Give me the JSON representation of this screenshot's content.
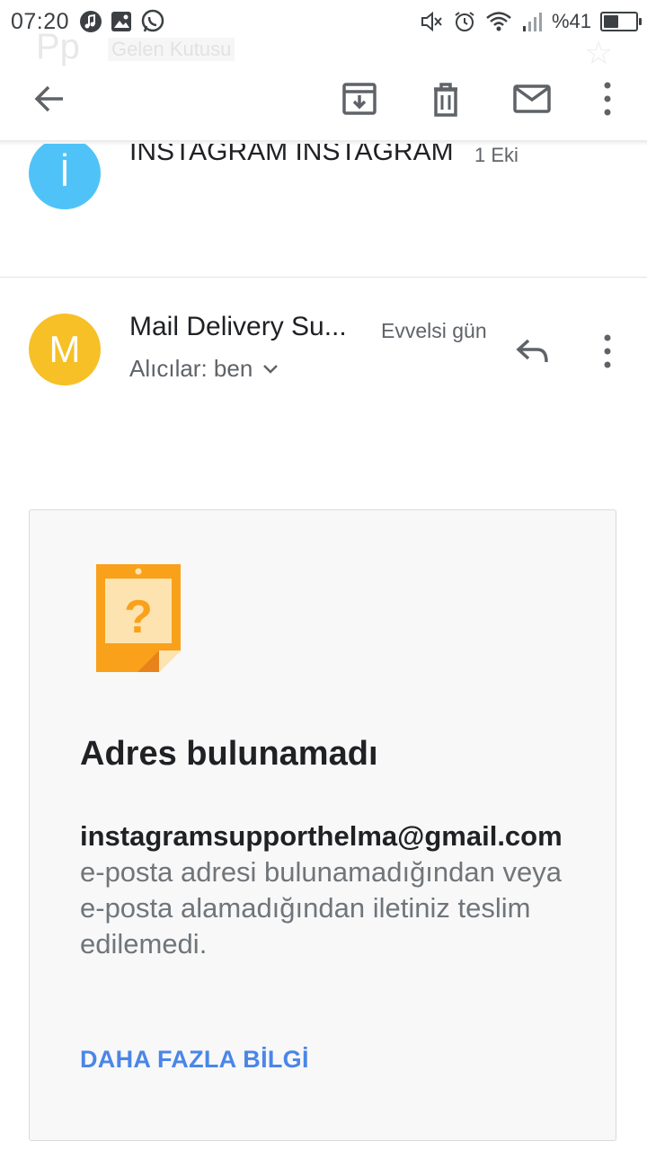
{
  "status_bar": {
    "time": "07:20",
    "left_icons": [
      "music-note-icon",
      "image-icon",
      "whatsapp-icon"
    ],
    "right_icons": [
      "mute-icon",
      "alarm-icon",
      "wifi-icon",
      "signal-icon"
    ],
    "battery_text": "%41",
    "battery_level": 0.41
  },
  "background": {
    "faded_initials": "Pp",
    "faded_folder_label": "Gelen Kutusu"
  },
  "toolbar": {
    "icons": [
      "back-arrow-icon",
      "archive-icon",
      "delete-icon",
      "mark-unread-icon",
      "more-vert-icon"
    ]
  },
  "messages": [
    {
      "avatar_letter": "İ",
      "avatar_color": "#4fc3f7",
      "sender": "İNSTAGRAM İNSTAGRAM",
      "date": "1 Eki"
    },
    {
      "avatar_letter": "M",
      "avatar_color": "#f6c026",
      "sender": "Mail Delivery Su...",
      "date": "Evvelsi gün",
      "recipients": "Alıcılar: ben"
    }
  ],
  "bounce_card": {
    "title": "Adres bulunamadı",
    "address": "instagramsupporthelma@gmail.com",
    "message": " e-posta adresi bulunamadığından veya e-posta alamadığından iletiniz teslim edilemedi.",
    "link": "DAHA FAZLA BİLGİ",
    "accent_color": "#f9a11b",
    "link_color": "#4a86e8"
  }
}
